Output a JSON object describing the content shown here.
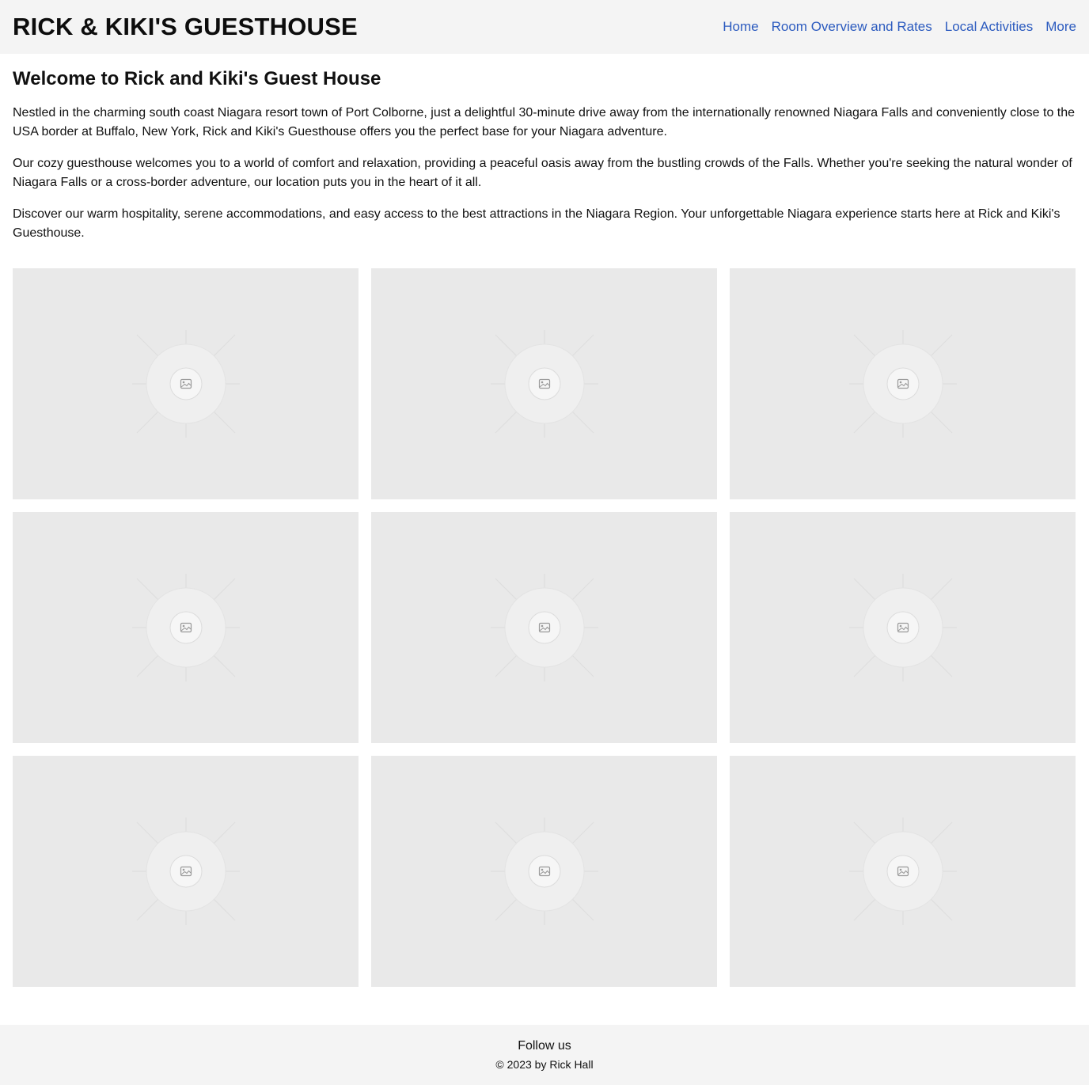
{
  "header": {
    "title": "RICK & KIKI'S GUESTHOUSE",
    "nav": [
      {
        "label": "Home"
      },
      {
        "label": "Room Overview and Rates"
      },
      {
        "label": "Local Activities"
      },
      {
        "label": "More"
      }
    ]
  },
  "main": {
    "heading": "Welcome to Rick and Kiki's Guest House",
    "paragraphs": [
      "Nestled in the charming south coast Niagara resort town of Port Colborne, just a delightful 30-minute drive away from the internationally renowned Niagara Falls and conveniently close to the USA border at Buffalo, New York, Rick and Kiki's Guesthouse offers you the perfect base for your Niagara adventure.",
      "Our cozy guesthouse welcomes you to a world of comfort and relaxation, providing a peaceful oasis away from the bustling crowds of the Falls. Whether you're seeking the natural wonder of Niagara Falls or a cross-border adventure, our location puts you in the heart of it all.",
      "Discover our warm hospitality, serene accommodations, and easy access to the best attractions in the Niagara Region. Your unforgettable Niagara experience starts here at Rick and Kiki's Guesthouse."
    ],
    "gallery_icon": "image-placeholder-icon",
    "gallery_count": 9
  },
  "footer": {
    "follow": "Follow us",
    "copyright": "© 2023 by Rick Hall"
  },
  "colors": {
    "header_bg": "#f4f4f4",
    "link": "#2c5bbf",
    "placeholder": "#e9e9e9"
  }
}
